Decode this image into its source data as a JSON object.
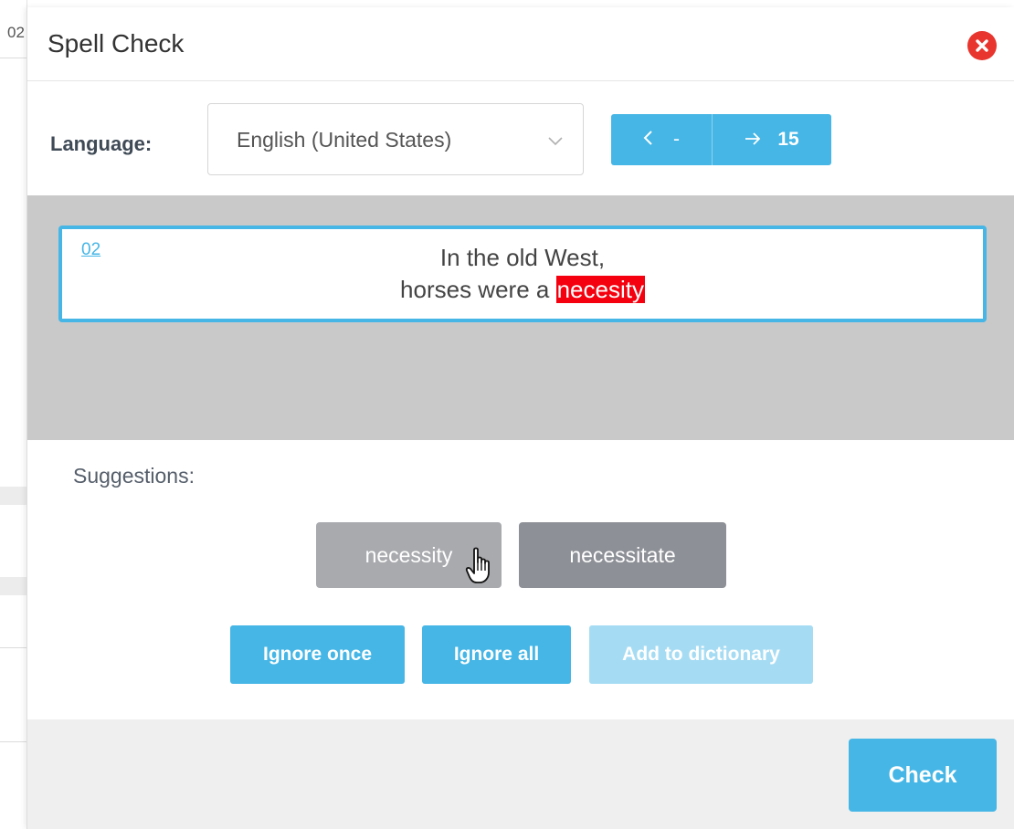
{
  "background": {
    "partial_text": "02"
  },
  "dialog": {
    "title": "Spell Check",
    "close_icon": "close-circle-icon"
  },
  "language": {
    "label": "Language:",
    "selected": "English (United States)"
  },
  "navigation": {
    "prev_icon": "chevron-left-icon",
    "prev_label": "-",
    "next_icon": "arrow-right-icon",
    "next_label": "15"
  },
  "preview": {
    "ref": "02",
    "line1": "In the old West,",
    "line2_prefix": "horses were a ",
    "misspelled_word": "necesity"
  },
  "suggestions": {
    "label": "Suggestions:",
    "items": [
      "necessity",
      "necessitate"
    ]
  },
  "actions": {
    "ignore_once": "Ignore once",
    "ignore_all": "Ignore all",
    "add_to_dictionary": "Add to dictionary"
  },
  "footer": {
    "check": "Check"
  },
  "colors": {
    "accent": "#45b6e6",
    "accent_disabled": "#a6dcf3",
    "error_highlight": "#f4000f",
    "close": "#e8352e"
  }
}
